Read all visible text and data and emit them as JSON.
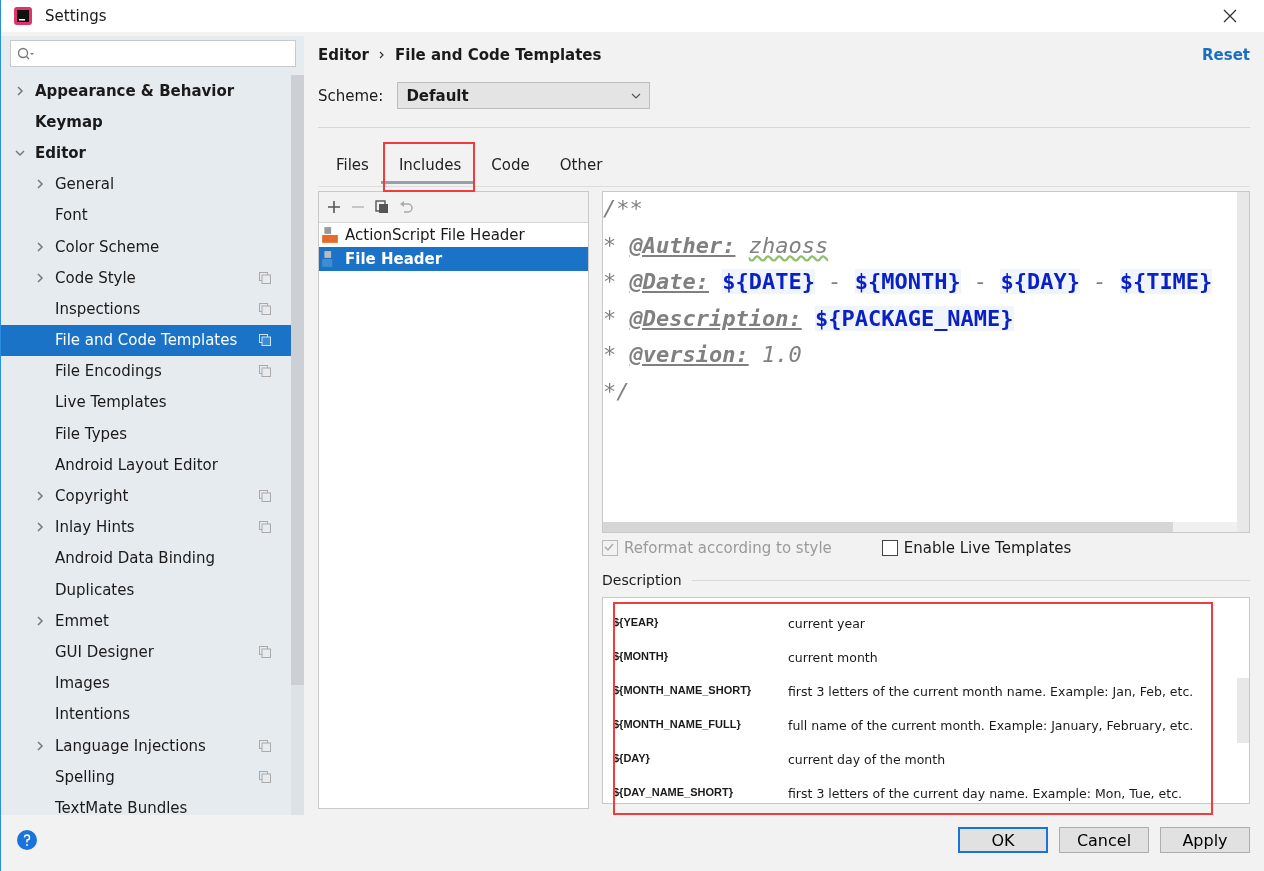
{
  "window": {
    "title": "Settings"
  },
  "sidebar": {
    "items": [
      {
        "label": "Appearance & Behavior",
        "expandable": true,
        "selected": false,
        "project_scope": false
      },
      {
        "label": "Keymap",
        "expandable": false,
        "selected": false,
        "project_scope": false
      },
      {
        "label": "Editor",
        "expandable": true,
        "expanded": true,
        "selected": false,
        "project_scope": false,
        "children": [
          {
            "label": "General",
            "expandable": true,
            "selected": false,
            "project_scope": false
          },
          {
            "label": "Font",
            "expandable": false,
            "selected": false,
            "project_scope": false
          },
          {
            "label": "Color Scheme",
            "expandable": true,
            "selected": false,
            "project_scope": false
          },
          {
            "label": "Code Style",
            "expandable": true,
            "selected": false,
            "project_scope": true
          },
          {
            "label": "Inspections",
            "expandable": false,
            "selected": false,
            "project_scope": true
          },
          {
            "label": "File and Code Templates",
            "expandable": false,
            "selected": true,
            "project_scope": true
          },
          {
            "label": "File Encodings",
            "expandable": false,
            "selected": false,
            "project_scope": true
          },
          {
            "label": "Live Templates",
            "expandable": false,
            "selected": false,
            "project_scope": false
          },
          {
            "label": "File Types",
            "expandable": false,
            "selected": false,
            "project_scope": false
          },
          {
            "label": "Android Layout Editor",
            "expandable": false,
            "selected": false,
            "project_scope": false
          },
          {
            "label": "Copyright",
            "expandable": true,
            "selected": false,
            "project_scope": true
          },
          {
            "label": "Inlay Hints",
            "expandable": true,
            "selected": false,
            "project_scope": true
          },
          {
            "label": "Android Data Binding",
            "expandable": false,
            "selected": false,
            "project_scope": false
          },
          {
            "label": "Duplicates",
            "expandable": false,
            "selected": false,
            "project_scope": false
          },
          {
            "label": "Emmet",
            "expandable": true,
            "selected": false,
            "project_scope": false
          },
          {
            "label": "GUI Designer",
            "expandable": false,
            "selected": false,
            "project_scope": true
          },
          {
            "label": "Images",
            "expandable": false,
            "selected": false,
            "project_scope": false
          },
          {
            "label": "Intentions",
            "expandable": false,
            "selected": false,
            "project_scope": false
          },
          {
            "label": "Language Injections",
            "expandable": true,
            "selected": false,
            "project_scope": true
          },
          {
            "label": "Spelling",
            "expandable": false,
            "selected": false,
            "project_scope": true
          },
          {
            "label": "TextMate Bundles",
            "expandable": false,
            "selected": false,
            "project_scope": false
          }
        ]
      }
    ]
  },
  "breadcrumb": [
    "Editor",
    "File and Code Templates"
  ],
  "reset_link": "Reset",
  "scheme": {
    "label": "Scheme:",
    "value": "Default"
  },
  "tabs": [
    {
      "label": "Files",
      "selected": false,
      "highlighted": false
    },
    {
      "label": "Includes",
      "selected": true,
      "highlighted": true
    },
    {
      "label": "Code",
      "selected": false,
      "highlighted": false
    },
    {
      "label": "Other",
      "selected": false,
      "highlighted": false
    }
  ],
  "templates": [
    {
      "label": "ActionScript File Header",
      "kind": "actionscript",
      "selected": false
    },
    {
      "label": "File Header",
      "kind": "java",
      "selected": true
    }
  ],
  "code_lines": [
    [
      {
        "kind": "text",
        "text": "/**"
      }
    ],
    [
      {
        "kind": "text",
        "text": "* "
      },
      {
        "kind": "tag",
        "text": "@Auther:"
      },
      {
        "kind": "typo",
        "text": "zhaoss"
      }
    ],
    [
      {
        "kind": "text",
        "text": "* "
      },
      {
        "kind": "tag",
        "text": "@Date:"
      },
      {
        "kind": "var",
        "text": "${DATE}"
      },
      {
        "kind": "text",
        "text": " - "
      },
      {
        "kind": "var",
        "text": "${MONTH}"
      },
      {
        "kind": "text",
        "text": " - "
      },
      {
        "kind": "var",
        "text": "${DAY}"
      },
      {
        "kind": "text",
        "text": " - "
      },
      {
        "kind": "var",
        "text": "${TIME}"
      }
    ],
    [
      {
        "kind": "text",
        "text": "* "
      },
      {
        "kind": "tag",
        "text": "@Description:"
      },
      {
        "kind": "var",
        "text": "${PACKAGE_NAME}"
      }
    ],
    [
      {
        "kind": "text",
        "text": "* "
      },
      {
        "kind": "tag",
        "text": "@version:"
      },
      {
        "kind": "text",
        "text": "1.0"
      }
    ],
    [
      {
        "kind": "text",
        "text": "*/"
      }
    ]
  ],
  "options": [
    {
      "label": "Reformat according to style",
      "checked": true,
      "disabled": true
    },
    {
      "label": "Enable Live Templates",
      "checked": false,
      "disabled": false
    }
  ],
  "description": {
    "title": "Description",
    "highlighted": true,
    "rows": [
      {
        "variable": "${YEAR}",
        "text": "current year"
      },
      {
        "variable": "${MONTH}",
        "text": "current month"
      },
      {
        "variable": "${MONTH_NAME_SHORT}",
        "text": "first 3 letters of the current month name. Example: Jan, Feb, etc."
      },
      {
        "variable": "${MONTH_NAME_FULL}",
        "text": "full name of the current month. Example: January, February, etc."
      },
      {
        "variable": "${DAY}",
        "text": "current day of the month"
      },
      {
        "variable": "${DAY_NAME_SHORT}",
        "text": "first 3 letters of the current day name. Example: Mon, Tue, etc."
      }
    ]
  },
  "buttons": [
    {
      "label": "OK",
      "default": true
    },
    {
      "label": "Cancel",
      "default": false
    },
    {
      "label": "Apply",
      "default": false
    }
  ]
}
